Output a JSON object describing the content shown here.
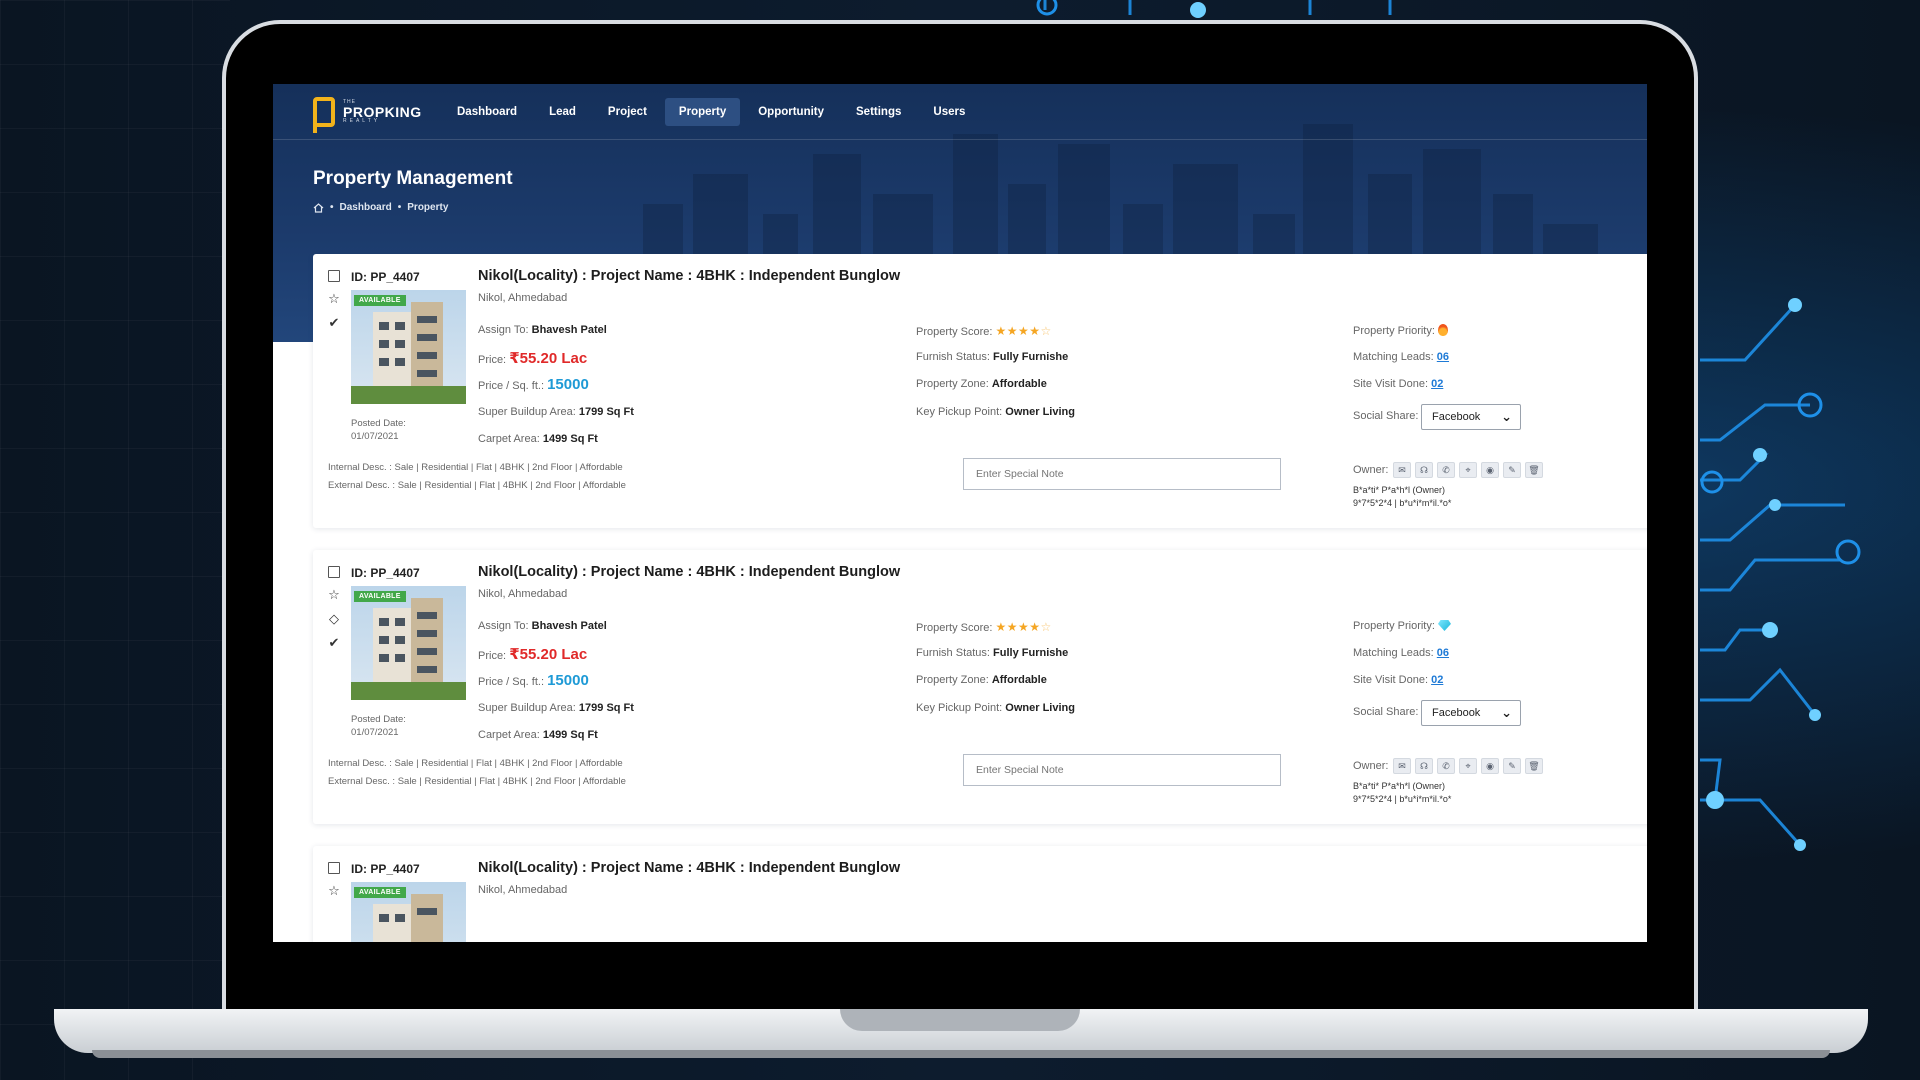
{
  "brand": {
    "small": "THE",
    "name": "PROPKING",
    "sub": "REALTY"
  },
  "nav": {
    "items": [
      {
        "label": "Dashboard",
        "active": false
      },
      {
        "label": "Lead",
        "active": false
      },
      {
        "label": "Project",
        "active": false
      },
      {
        "label": "Property",
        "active": true
      },
      {
        "label": "Opportunity",
        "active": false
      },
      {
        "label": "Settings",
        "active": false
      },
      {
        "label": "Users",
        "active": false
      }
    ]
  },
  "page": {
    "title": "Property Management",
    "breadcrumb": [
      "Dashboard",
      "Property"
    ]
  },
  "colors": {
    "accent": "#2d4f82",
    "price": "#e02929",
    "psf": "#1e9ad6",
    "badge": "#42a84a",
    "star": "#f5a623"
  },
  "labels": {
    "assign_to": "Assign To:",
    "price": "Price:",
    "price_per_sqft": "Price / Sq. ft.:",
    "super_buildup": "Super Buildup Area:",
    "carpet_area": "Carpet Area:",
    "property_score": "Property Score:",
    "furnish_status": "Furnish Status:",
    "property_zone": "Property Zone:",
    "key_pickup": "Key Pickup Point:",
    "property_priority": "Property Priority:",
    "matching_leads": "Matching Leads:",
    "site_visit_done": "Site Visit Done:",
    "social_share": "Social Share:",
    "internal_desc": "Internal Desc. :",
    "external_desc": "External Desc. :",
    "owner": "Owner:",
    "posted_date": "Posted Date:",
    "note_placeholder": "Enter Special Note",
    "badge": "AVAILABLE"
  },
  "properties": [
    {
      "id": "ID: PP_4407",
      "title": "Nikol(Locality) : Project Name : 4BHK : Independent Bunglow",
      "location": "Nikol, Ahmedabad",
      "assign_to": "Bhavesh Patel",
      "price": "₹55.20 Lac",
      "price_per_sqft": "15000",
      "super_buildup": "1799 Sq Ft",
      "carpet_area": "1499 Sq Ft",
      "posted_date": "01/07/2021",
      "score": 4,
      "furnish_status": "Fully Furnishe",
      "property_zone": "Affordable",
      "key_pickup": "Owner Living",
      "priority_icon": "fire-icon",
      "matching_leads": "06",
      "site_visit_done": "02",
      "social_share": "Facebook",
      "internal_desc": "Sale | Residential | Flat | 4BHK | 2nd Floor | Affordable",
      "external_desc": "Sale | Residential | Flat | 4BHK | 2nd Floor | Affordable",
      "owner_name": "B*a*ti* P*a*h*l (Owner)",
      "owner_contact": "9*7*5*2*4 | b*u*i*m*il.*o*",
      "side_icons": [
        "star-outline-icon",
        "check-icon"
      ]
    },
    {
      "id": "ID: PP_4407",
      "title": "Nikol(Locality) : Project Name : 4BHK : Independent Bunglow",
      "location": "Nikol, Ahmedabad",
      "assign_to": "Bhavesh Patel",
      "price": "₹55.20 Lac",
      "price_per_sqft": "15000",
      "super_buildup": "1799 Sq Ft",
      "carpet_area": "1499 Sq Ft",
      "posted_date": "01/07/2021",
      "score": 4,
      "furnish_status": "Fully Furnishe",
      "property_zone": "Affordable",
      "key_pickup": "Owner Living",
      "priority_icon": "diamond-icon",
      "matching_leads": "06",
      "site_visit_done": "02",
      "social_share": "Facebook",
      "internal_desc": "Sale | Residential | Flat | 4BHK | 2nd Floor | Affordable",
      "external_desc": "Sale | Residential | Flat | 4BHK | 2nd Floor | Affordable",
      "owner_name": "B*a*ti* P*a*h*l (Owner)",
      "owner_contact": "9*7*5*2*4 | b*u*i*m*il.*o*",
      "side_icons": [
        "star-outline-icon",
        "diamond-outline-icon",
        "check-icon"
      ]
    },
    {
      "id": "ID: PP_4407",
      "title": "Nikol(Locality) : Project Name : 4BHK : Independent Bunglow",
      "location": "Nikol, Ahmedabad",
      "side_icons": [
        "star-outline-icon"
      ]
    }
  ],
  "owner_actions": [
    "mail-icon",
    "headset-icon",
    "whatsapp-icon",
    "location-pin-icon",
    "eye-icon",
    "edit-icon",
    "trash-icon"
  ]
}
